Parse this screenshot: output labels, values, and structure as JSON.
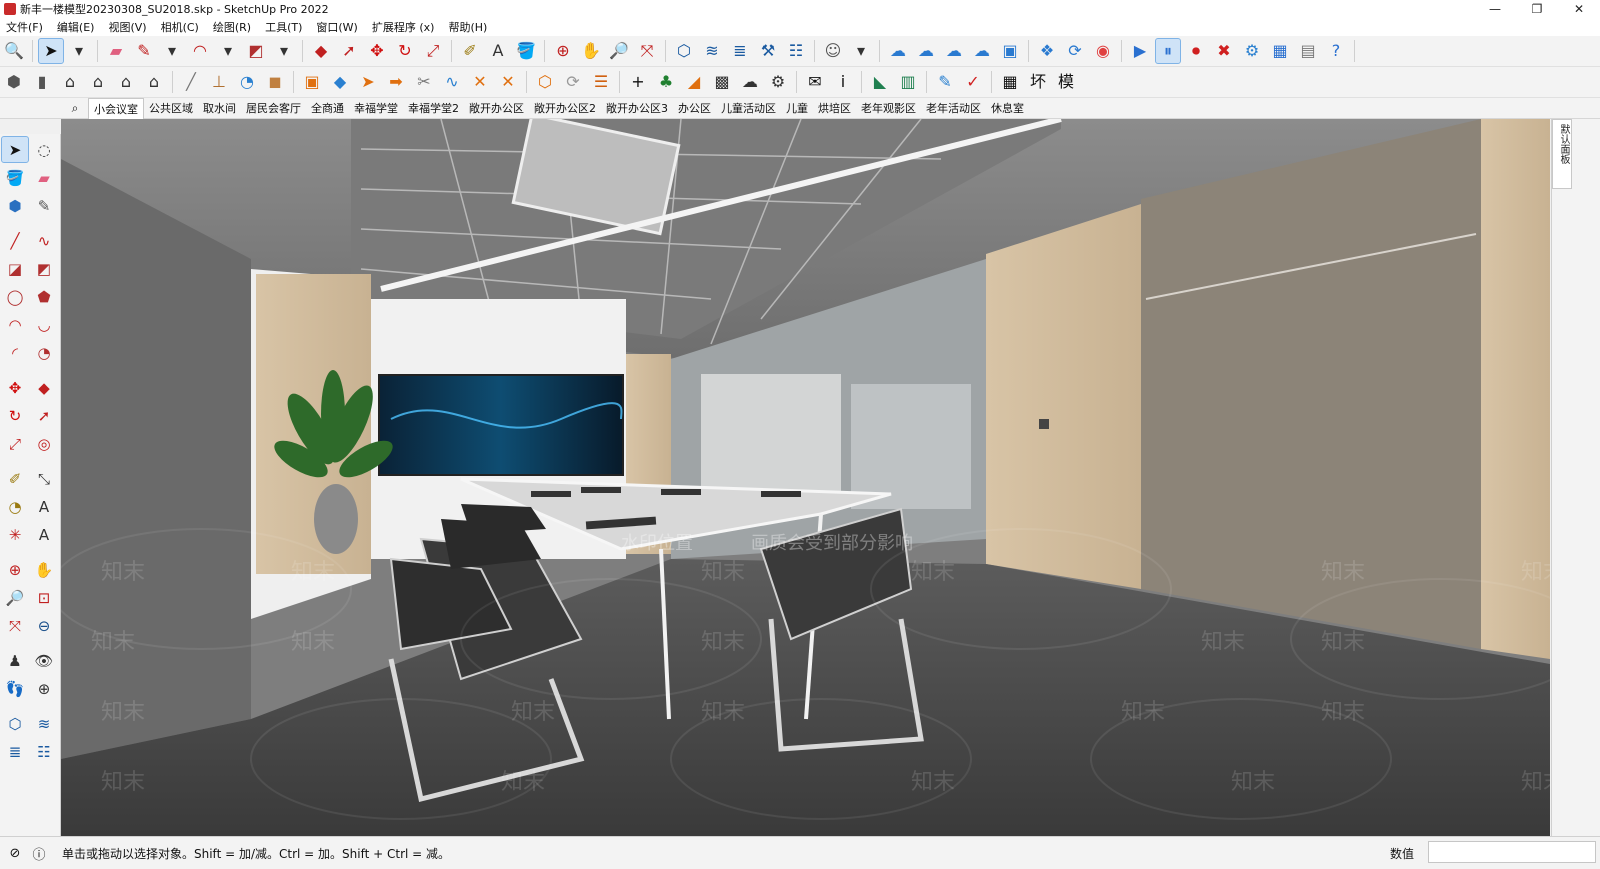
{
  "window": {
    "title": "新丰一楼模型20230308_SU2018.skp - SketchUp Pro 2022",
    "controls": [
      "—",
      "❐",
      "✕"
    ]
  },
  "menu": [
    "文件(F)",
    "编辑(E)",
    "视图(V)",
    "相机(C)",
    "绘图(R)",
    "工具(T)",
    "窗口(W)",
    "扩展程序 (x)",
    "帮助(H)"
  ],
  "toolbar_row1": [
    {
      "icon": "zoom-icon",
      "glyph": "🔍",
      "color": "#333333"
    },
    {
      "icon": "select-arrow-icon",
      "glyph": "➤",
      "color": "#111111",
      "active": true
    },
    {
      "icon": "dropdown-arrow-icon",
      "glyph": "▾",
      "color": "#333333"
    },
    {
      "icon": "eraser-icon",
      "glyph": "▰",
      "color": "#e06080"
    },
    {
      "icon": "pencil-icon",
      "glyph": "✎",
      "color": "#c02020"
    },
    {
      "icon": "dropdown-arrow-icon",
      "glyph": "▾",
      "color": "#333333"
    },
    {
      "icon": "arc-icon",
      "glyph": "◠",
      "color": "#c02020"
    },
    {
      "icon": "dropdown-arrow-icon",
      "glyph": "▾",
      "color": "#333333"
    },
    {
      "icon": "rectangle-icon",
      "glyph": "◩",
      "color": "#b03030"
    },
    {
      "icon": "dropdown-arrow-icon",
      "glyph": "▾",
      "color": "#333333"
    },
    {
      "icon": "push-pull-icon",
      "glyph": "◆",
      "color": "#c02020"
    },
    {
      "icon": "follow-me-icon",
      "glyph": "➚",
      "color": "#c02020"
    },
    {
      "icon": "move-icon",
      "glyph": "✥",
      "color": "#d01010"
    },
    {
      "icon": "rotate-icon",
      "glyph": "↻",
      "color": "#d01010"
    },
    {
      "icon": "scale-icon",
      "glyph": "⤢",
      "color": "#c02020"
    },
    {
      "icon": "tape-measure-icon",
      "glyph": "✐",
      "color": "#9a7a10"
    },
    {
      "icon": "text-icon",
      "glyph": "A",
      "color": "#333333"
    },
    {
      "icon": "paint-bucket-icon",
      "glyph": "🪣",
      "color": "#c07020"
    },
    {
      "icon": "orbit-icon",
      "glyph": "⊕",
      "color": "#c02020"
    },
    {
      "icon": "pan-icon",
      "glyph": "✋",
      "color": "#d09050"
    },
    {
      "icon": "zoom-tool-icon",
      "glyph": "🔎",
      "color": "#1a4f8a"
    },
    {
      "icon": "zoom-extents-icon",
      "glyph": "⤧",
      "color": "#c02020"
    },
    {
      "icon": "sandbox-contours-icon",
      "glyph": "⬡",
      "color": "#1a5aa0"
    },
    {
      "icon": "sandbox-scratch-icon",
      "glyph": "≋",
      "color": "#1a5aa0"
    },
    {
      "icon": "sandbox-smoove-icon",
      "glyph": "≣",
      "color": "#1a5aa0"
    },
    {
      "icon": "sandbox-stamp-icon",
      "glyph": "⚒",
      "color": "#1a5aa0"
    },
    {
      "icon": "sandbox-drape-icon",
      "glyph": "☷",
      "color": "#1a5aa0"
    },
    {
      "icon": "account-icon",
      "glyph": "☺",
      "color": "#555555"
    },
    {
      "icon": "dropdown-arrow-icon",
      "glyph": "▾",
      "color": "#333333"
    },
    {
      "icon": "trimble-connect-icon",
      "glyph": "☁",
      "color": "#2a7ad0"
    },
    {
      "icon": "cloud-search-icon",
      "glyph": "☁",
      "color": "#2a7ad0"
    },
    {
      "icon": "cloud-upload-icon",
      "glyph": "☁",
      "color": "#2a7ad0"
    },
    {
      "icon": "cloud-sync-icon",
      "glyph": "☁",
      "color": "#2a7ad0"
    },
    {
      "icon": "extension-manager-icon",
      "glyph": "▣",
      "color": "#2a7ad0"
    },
    {
      "icon": "3d-warehouse-icon",
      "glyph": "❖",
      "color": "#2a7ad0"
    },
    {
      "icon": "extension-warehouse-icon",
      "glyph": "⟳",
      "color": "#2a7ad0"
    },
    {
      "icon": "chrome-browser-icon",
      "glyph": "◉",
      "color": "#e04040"
    },
    {
      "icon": "play-icon",
      "glyph": "▶",
      "color": "#2a70d0"
    },
    {
      "icon": "pause-icon",
      "glyph": "⏸",
      "color": "#2a70d0",
      "active": true
    },
    {
      "icon": "record-icon",
      "glyph": "⏺",
      "color": "#d02020"
    },
    {
      "icon": "stop-icon",
      "glyph": "✖",
      "color": "#d02020"
    },
    {
      "icon": "settings-gear-icon",
      "glyph": "⚙",
      "color": "#2a80d0"
    },
    {
      "icon": "render-window-icon",
      "glyph": "▦",
      "color": "#2a70d0"
    },
    {
      "icon": "frame-buffer-icon",
      "glyph": "▤",
      "color": "#777777"
    },
    {
      "icon": "help-icon",
      "glyph": "?",
      "color": "#2a70d0"
    }
  ],
  "toolbar_row2": [
    {
      "icon": "component-icon",
      "glyph": "⬢",
      "color": "#555555"
    },
    {
      "icon": "book-icon",
      "glyph": "▮",
      "color": "#555555"
    },
    {
      "icon": "house-icon",
      "glyph": "⌂",
      "color": "#333333"
    },
    {
      "icon": "house-front-icon",
      "glyph": "⌂",
      "color": "#333333"
    },
    {
      "icon": "house-outline-icon",
      "glyph": "⌂",
      "color": "#333333"
    },
    {
      "icon": "garage-icon",
      "glyph": "⌂",
      "color": "#333333"
    },
    {
      "icon": "line-tool-icon",
      "glyph": "╱",
      "color": "#777777"
    },
    {
      "icon": "dimension-icon",
      "glyph": "⊥",
      "color": "#b07030"
    },
    {
      "icon": "protractor-icon",
      "glyph": "◔",
      "color": "#2a80d0"
    },
    {
      "icon": "wood-block-icon",
      "glyph": "◼",
      "color": "#c08040"
    },
    {
      "icon": "cabinet-icon",
      "glyph": "▣",
      "color": "#e07010"
    },
    {
      "icon": "shape-icon",
      "glyph": "◆",
      "color": "#2a80d0"
    },
    {
      "icon": "arrow-shape-icon",
      "glyph": "➤",
      "color": "#e07010"
    },
    {
      "icon": "arrow-right-icon",
      "glyph": "➡",
      "color": "#e07010"
    },
    {
      "icon": "scissors-icon",
      "glyph": "✂",
      "color": "#777777"
    },
    {
      "icon": "curve-icon",
      "glyph": "∿",
      "color": "#2a80d0"
    },
    {
      "icon": "point-marker-icon",
      "glyph": "✕",
      "color": "#e07010"
    },
    {
      "icon": "point-marker-icon-2",
      "glyph": "✕",
      "color": "#e07010"
    },
    {
      "icon": "solid-tools-icon",
      "glyph": "⬡",
      "color": "#e07010"
    },
    {
      "icon": "refresh-icon",
      "glyph": "⟳",
      "color": "#999999"
    },
    {
      "icon": "layer-stack-icon",
      "glyph": "☰",
      "color": "#d06010"
    },
    {
      "icon": "add-circle-icon",
      "glyph": "+",
      "color": "#111111"
    },
    {
      "icon": "tree-icon",
      "glyph": "♣",
      "color": "#208030"
    },
    {
      "icon": "roof-icon",
      "glyph": "◢",
      "color": "#e07010"
    },
    {
      "icon": "checker-icon",
      "glyph": "▩",
      "color": "#333333"
    },
    {
      "icon": "cloud-dark-icon",
      "glyph": "☁",
      "color": "#333333"
    },
    {
      "icon": "settings-icon",
      "glyph": "⚙",
      "color": "#333333"
    },
    {
      "icon": "mail-icon",
      "glyph": "✉",
      "color": "#111111"
    },
    {
      "icon": "info-icon",
      "glyph": "i",
      "color": "#111111"
    },
    {
      "icon": "stairs-icon",
      "glyph": "◣",
      "color": "#208050"
    },
    {
      "icon": "ens-icon",
      "glyph": "▥",
      "color": "#208050"
    },
    {
      "icon": "brush-icon",
      "glyph": "✎",
      "color": "#2a80d0"
    },
    {
      "icon": "check-icon",
      "glyph": "✓",
      "color": "#d02020"
    },
    {
      "icon": "table-icon",
      "glyph": "▦",
      "color": "#111111"
    },
    {
      "icon": "char-huan-icon",
      "glyph": "坏",
      "color": "#111111"
    },
    {
      "icon": "char-mo-icon",
      "glyph": "模",
      "color": "#111111"
    }
  ],
  "scene_tabs": [
    "小会议室",
    "公共区域",
    "取水间",
    "居民会客厅",
    "全商通",
    "幸福学堂",
    "幸福学堂2",
    "敞开办公区",
    "敞开办公区2",
    "敞开办公区3",
    "办公区",
    "儿童活动区",
    "儿童",
    "烘培区",
    "老年观影区",
    "老年活动区",
    "休息室"
  ],
  "left_tools": [
    {
      "icon": "select-icon",
      "glyph": "➤",
      "color": "#111111",
      "active": true
    },
    {
      "icon": "lasso-icon",
      "glyph": "◌",
      "color": "#333333"
    },
    {
      "icon": "paint-icon",
      "glyph": "🪣",
      "color": "#c07020"
    },
    {
      "icon": "eraser-icon",
      "glyph": "▰",
      "color": "#e06080"
    },
    {
      "icon": "component-icon",
      "glyph": "⬢",
      "color": "#2a70c0"
    },
    {
      "icon": "make-group-icon",
      "glyph": "✎",
      "color": "#555555"
    },
    {
      "gap": true
    },
    {
      "icon": "line-icon",
      "glyph": "╱",
      "color": "#c02020"
    },
    {
      "icon": "freehand-icon",
      "glyph": "∿",
      "color": "#c02020"
    },
    {
      "icon": "rectangle-icon",
      "glyph": "◪",
      "color": "#b03030"
    },
    {
      "icon": "rotated-rectangle-icon",
      "glyph": "◩",
      "color": "#b03030"
    },
    {
      "icon": "circle-icon",
      "glyph": "◯",
      "color": "#b03030"
    },
    {
      "icon": "polygon-icon",
      "glyph": "⬟",
      "color": "#b03030"
    },
    {
      "icon": "arc-icon",
      "glyph": "◠",
      "color": "#c02020"
    },
    {
      "icon": "two-point-arc-icon",
      "glyph": "◡",
      "color": "#c02020"
    },
    {
      "icon": "three-point-arc-icon",
      "glyph": "◜",
      "color": "#c02020"
    },
    {
      "icon": "pie-icon",
      "glyph": "◔",
      "color": "#b03030"
    },
    {
      "gap": true
    },
    {
      "icon": "move-icon",
      "glyph": "✥",
      "color": "#d01010"
    },
    {
      "icon": "push-pull-icon",
      "glyph": "◆",
      "color": "#c02020"
    },
    {
      "icon": "rotate-icon",
      "glyph": "↻",
      "color": "#d01010"
    },
    {
      "icon": "follow-me-icon",
      "glyph": "➚",
      "color": "#c02020"
    },
    {
      "icon": "scale-icon",
      "glyph": "⤢",
      "color": "#c02020"
    },
    {
      "icon": "offset-icon",
      "glyph": "◎",
      "color": "#c02020"
    },
    {
      "gap": true
    },
    {
      "icon": "tape-measure-icon",
      "glyph": "✐",
      "color": "#9a7a10"
    },
    {
      "icon": "dimension-icon",
      "glyph": "⤡",
      "color": "#333333"
    },
    {
      "icon": "protractor-icon",
      "glyph": "◔",
      "color": "#9a7a10"
    },
    {
      "icon": "text-icon",
      "glyph": "A",
      "color": "#333333"
    },
    {
      "icon": "axes-icon",
      "glyph": "✳",
      "color": "#c02020"
    },
    {
      "icon": "3d-text-icon",
      "glyph": "A",
      "color": "#333333"
    },
    {
      "gap": true
    },
    {
      "icon": "orbit-icon",
      "glyph": "⊕",
      "color": "#c02020"
    },
    {
      "icon": "pan-icon",
      "glyph": "✋",
      "color": "#d09050"
    },
    {
      "icon": "zoom-icon",
      "glyph": "🔎",
      "color": "#1a4f8a"
    },
    {
      "icon": "zoom-window-icon",
      "glyph": "⊡",
      "color": "#c02020"
    },
    {
      "icon": "zoom-extents-icon",
      "glyph": "⤧",
      "color": "#c02020"
    },
    {
      "icon": "previous-view-icon",
      "glyph": "⊖",
      "color": "#1a4f8a"
    },
    {
      "gap": true
    },
    {
      "icon": "position-camera-icon",
      "glyph": "♟",
      "color": "#333333"
    },
    {
      "icon": "look-around-icon",
      "glyph": "👁",
      "color": "#333333"
    },
    {
      "icon": "walk-icon",
      "glyph": "👣",
      "color": "#333333"
    },
    {
      "icon": "section-plane-icon",
      "glyph": "⊕",
      "color": "#333333"
    },
    {
      "gap": true
    },
    {
      "icon": "sandbox-contours-icon",
      "glyph": "⬡",
      "color": "#1a5aa0"
    },
    {
      "icon": "sandbox-scratch-icon",
      "glyph": "≋",
      "color": "#1a5aa0"
    },
    {
      "icon": "sandbox-smoove-icon",
      "glyph": "≣",
      "color": "#1a5aa0"
    },
    {
      "icon": "sandbox-drape-icon",
      "glyph": "☷",
      "color": "#1a5aa0"
    }
  ],
  "viewport": {
    "watermarks": [
      "知末",
      "水印位置",
      "画质会受到部分影响"
    ]
  },
  "right_tray": {
    "label": "默认面板"
  },
  "status": {
    "text": "单击或拖动以选择对象。Shift = 加/减。Ctrl = 加。Shift + Ctrl = 减。",
    "measure_label": "数值",
    "measure_value": ""
  }
}
